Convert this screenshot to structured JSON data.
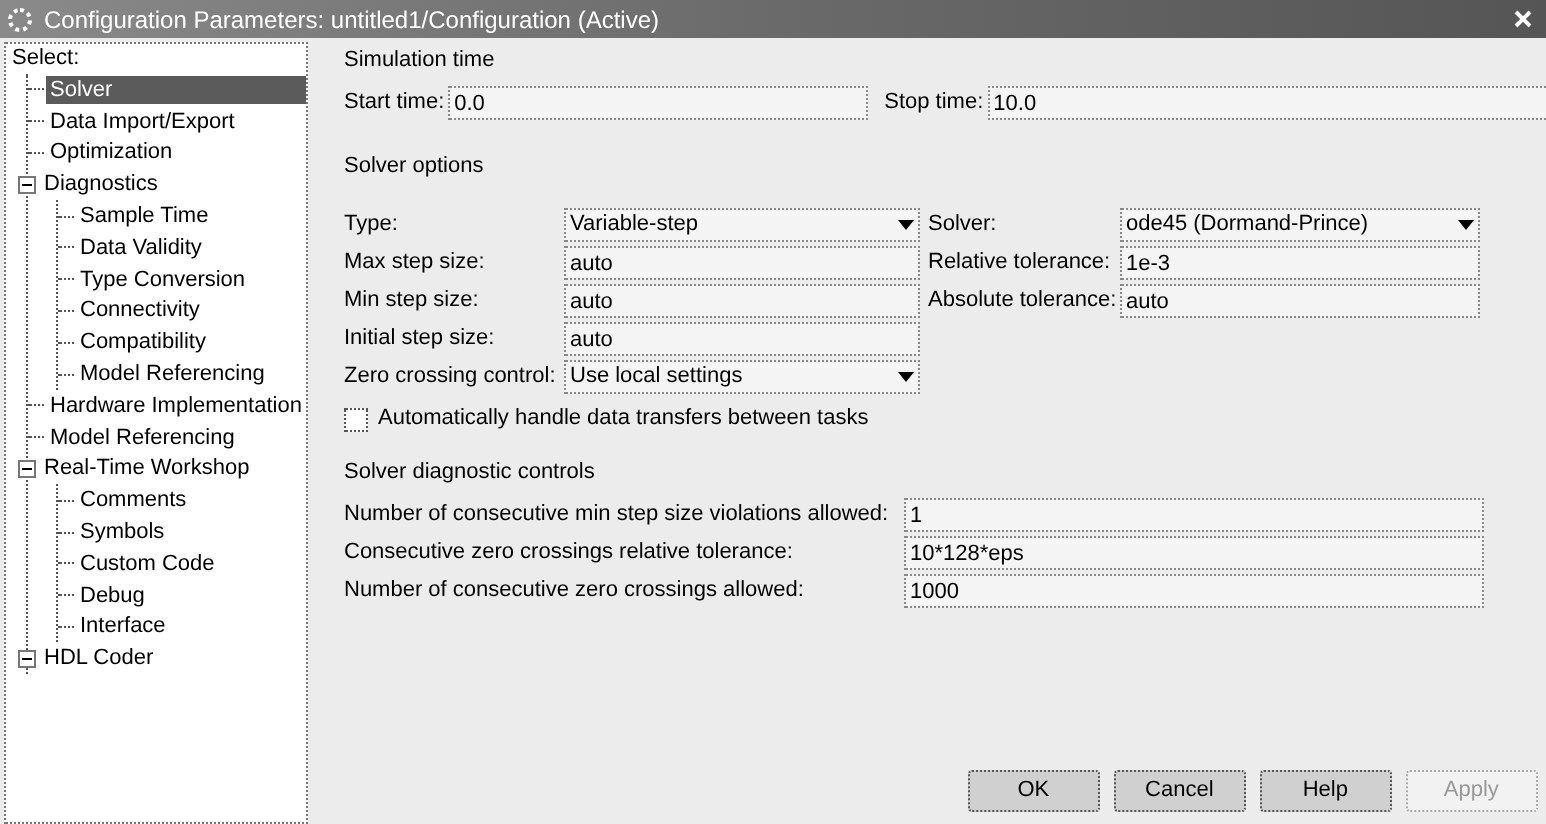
{
  "window": {
    "title": "Configuration Parameters: untitled1/Configuration (Active)"
  },
  "sidebar": {
    "title": "Select:",
    "items": [
      {
        "label": "Solver",
        "selected": true
      },
      {
        "label": "Data Import/Export",
        "selected": false
      },
      {
        "label": "Optimization",
        "selected": false
      },
      {
        "label": "Diagnostics",
        "selected": false,
        "expanded": true,
        "children": [
          {
            "label": "Sample Time",
            "selected": false
          },
          {
            "label": "Data Validity",
            "selected": false
          },
          {
            "label": "Type Conversion",
            "selected": false
          },
          {
            "label": "Connectivity",
            "selected": false
          },
          {
            "label": "Compatibility",
            "selected": false
          },
          {
            "label": "Model Referencing",
            "selected": false
          }
        ]
      },
      {
        "label": "Hardware Implementation",
        "selected": false
      },
      {
        "label": "Model Referencing",
        "selected": false
      },
      {
        "label": "Real-Time Workshop",
        "selected": false,
        "expanded": true,
        "children": [
          {
            "label": "Comments",
            "selected": false
          },
          {
            "label": "Symbols",
            "selected": false
          },
          {
            "label": "Custom Code",
            "selected": false
          },
          {
            "label": "Debug",
            "selected": false
          },
          {
            "label": "Interface",
            "selected": false
          }
        ]
      },
      {
        "label": "HDL Coder",
        "selected": false,
        "expanded": true
      }
    ]
  },
  "simulation_time": {
    "title": "Simulation time",
    "start_label": "Start time:",
    "start_value": "0.0",
    "stop_label": "Stop time:",
    "stop_value": "10.0"
  },
  "solver_options": {
    "title": "Solver options",
    "type": {
      "label": "Type:",
      "value": "Variable-step"
    },
    "solver": {
      "label": "Solver:",
      "value": "ode45 (Dormand-Prince)"
    },
    "left_fields": [
      {
        "label": "Max step size:",
        "value": "auto"
      },
      {
        "label": "Min step size:",
        "value": "auto"
      },
      {
        "label": "Initial step size:",
        "value": "auto"
      }
    ],
    "right_fields": [
      {
        "label": "Relative tolerance:",
        "value": "1e-3"
      },
      {
        "label": "Absolute tolerance:",
        "value": "auto"
      }
    ],
    "zero_crossing": {
      "label": "Zero crossing control:",
      "value": "Use local settings"
    },
    "auto_transfer": {
      "label": "Automatically handle data transfers between tasks",
      "checked": false
    }
  },
  "diagnostic_controls": {
    "title": "Solver diagnostic controls",
    "fields": [
      {
        "label": "Number of consecutive min step size violations allowed:",
        "value": "1"
      },
      {
        "label": "Consecutive zero crossings relative tolerance:",
        "value": "10*128*eps"
      },
      {
        "label": "Number of consecutive zero crossings allowed:",
        "value": "1000"
      }
    ]
  },
  "buttons": [
    {
      "label": "OK",
      "disabled": false
    },
    {
      "label": "Cancel",
      "disabled": false
    },
    {
      "label": "Help",
      "disabled": false
    },
    {
      "label": "Apply",
      "disabled": true
    }
  ]
}
